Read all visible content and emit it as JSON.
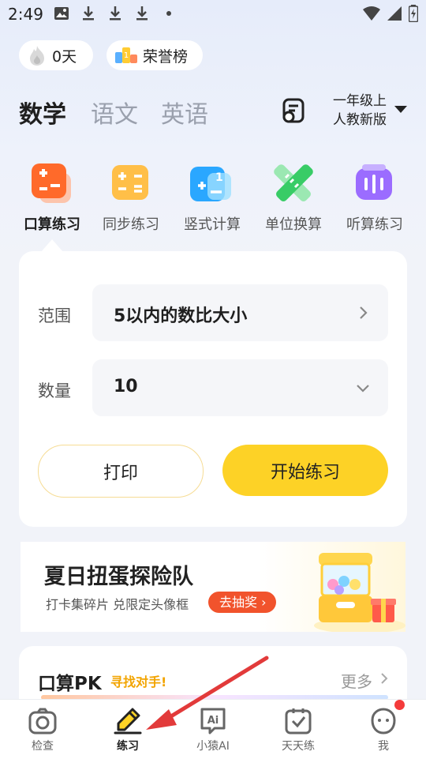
{
  "status_bar": {
    "time": "2:49",
    "icons": [
      "image-icon",
      "download-icon",
      "download-icon",
      "download-icon",
      "dot-icon",
      "wifi-icon",
      "signal-icon",
      "battery-icon"
    ]
  },
  "chips": {
    "streak": "0天",
    "rank": "荣誉榜"
  },
  "subjects": [
    "数学",
    "语文",
    "英语"
  ],
  "grade": {
    "line1": "一年级上",
    "line2": "人教新版"
  },
  "categories": [
    {
      "label": "口算练习",
      "color": "#ff7a2f"
    },
    {
      "label": "同步练习",
      "color": "#ffb020"
    },
    {
      "label": "竖式计算",
      "color": "#2aa7ff"
    },
    {
      "label": "单位换算",
      "color": "#38cc66"
    },
    {
      "label": "听算练习",
      "color": "#9b6cff"
    }
  ],
  "form": {
    "range_label": "范围",
    "range_value": "5以内的数比大小",
    "count_label": "数量",
    "count_value": "10",
    "print_button": "打印",
    "start_button": "开始练习"
  },
  "banner": {
    "title": "夏日扭蛋探险队",
    "subtitle": "打卡集碎片 兑限定头像框",
    "cta": "去抽奖"
  },
  "pk": {
    "title": "口算PK",
    "subtitle": "寻找对手!",
    "more": "更多"
  },
  "bottom_nav": [
    {
      "label": "检查"
    },
    {
      "label": "练习"
    },
    {
      "label": "小猿AI"
    },
    {
      "label": "天天练"
    },
    {
      "label": "我"
    }
  ],
  "colors": {
    "accent_yellow": "#fdd226",
    "cta_red": "#f1532c",
    "pk_orange": "#f2a400",
    "badge_red": "#f43b3b",
    "annotation_arrow": "#e23a3a"
  }
}
